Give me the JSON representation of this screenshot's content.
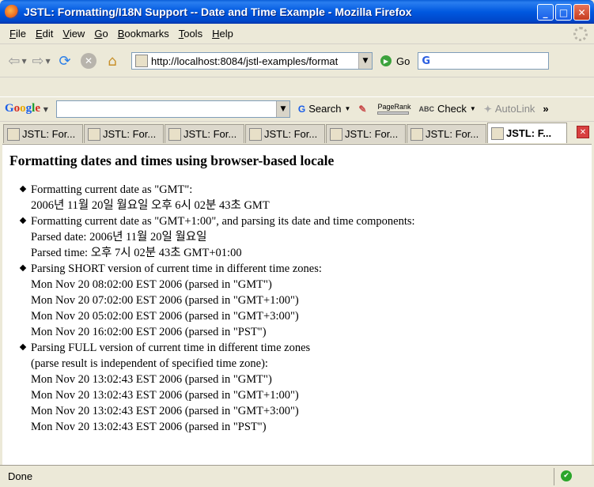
{
  "window": {
    "title": "JSTL: Formatting/I18N Support -- Date and Time Example - Mozilla Firefox",
    "minimize": "_",
    "maximize": "□",
    "close": "✕"
  },
  "menu": {
    "items": [
      {
        "label": "File",
        "u": "F",
        "rest": "ile"
      },
      {
        "label": "Edit",
        "u": "E",
        "rest": "dit"
      },
      {
        "label": "View",
        "u": "V",
        "rest": "iew"
      },
      {
        "label": "Go",
        "u": "G",
        "rest": "o"
      },
      {
        "label": "Bookmarks",
        "u": "B",
        "rest": "ookmarks"
      },
      {
        "label": "Tools",
        "u": "T",
        "rest": "ools"
      },
      {
        "label": "Help",
        "u": "H",
        "rest": "elp"
      }
    ]
  },
  "navbar": {
    "url": "http://localhost:8084/jstl-examples/format",
    "go_label": "Go",
    "search_engine_glyph": "G"
  },
  "googlebar": {
    "logo": {
      "G": "G",
      "o1": "o",
      "o2": "o",
      "g": "g",
      "l": "l",
      "e": "e"
    },
    "search_label": "Search",
    "pagerank_label": "PageRank",
    "check_label": "Check",
    "autolink_label": "AutoLink",
    "more": "»"
  },
  "tabs": [
    {
      "label": "JSTL: For..."
    },
    {
      "label": "JSTL: For..."
    },
    {
      "label": "JSTL: For..."
    },
    {
      "label": "JSTL: For..."
    },
    {
      "label": "JSTL: For..."
    },
    {
      "label": "JSTL: For..."
    },
    {
      "label": "JSTL: F...",
      "active": true
    }
  ],
  "page": {
    "heading": "Formatting dates and times using browser-based locale",
    "items": [
      {
        "lines": [
          "Formatting current date as \"GMT\":",
          "2006년 11월 20일 월요일 오후 6시 02분 43초 GMT"
        ]
      },
      {
        "lines": [
          "Formatting current date as \"GMT+1:00\", and parsing its date and time components:",
          "Parsed date: 2006년 11월 20일 월요일",
          "Parsed time: 오후 7시 02분 43초 GMT+01:00"
        ]
      },
      {
        "lines": [
          "Parsing SHORT version of current time in different time zones:",
          "Mon Nov 20 08:02:00 EST 2006 (parsed in \"GMT\")",
          "Mon Nov 20 07:02:00 EST 2006 (parsed in \"GMT+1:00\")",
          "Mon Nov 20 05:02:00 EST 2006 (parsed in \"GMT+3:00\")",
          "Mon Nov 20 16:02:00 EST 2006 (parsed in \"PST\")"
        ]
      },
      {
        "lines": [
          "Parsing FULL version of current time in different time zones",
          "(parse result is independent of specified time zone):",
          "Mon Nov 20 13:02:43 EST 2006 (parsed in \"GMT\")",
          "Mon Nov 20 13:02:43 EST 2006 (parsed in \"GMT+1:00\")",
          "Mon Nov 20 13:02:43 EST 2006 (parsed in \"GMT+3:00\")",
          "Mon Nov 20 13:02:43 EST 2006 (parsed in \"PST\")"
        ]
      }
    ]
  },
  "status": {
    "text": "Done"
  }
}
